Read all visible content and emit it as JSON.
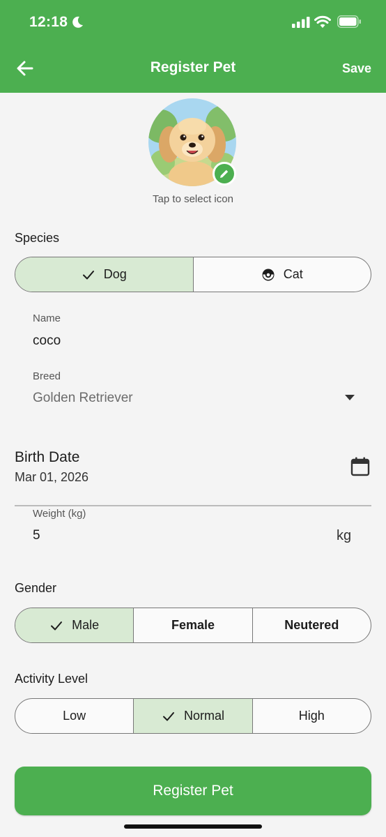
{
  "status_bar": {
    "time": "12:18"
  },
  "header": {
    "title": "Register Pet",
    "save_label": "Save",
    "accent_color": "#4caf50"
  },
  "avatar": {
    "caption": "Tap to select icon"
  },
  "species": {
    "label": "Species",
    "options": [
      {
        "label": "Dog",
        "selected": true,
        "icon": "check-icon"
      },
      {
        "label": "Cat",
        "selected": false,
        "icon": "cat-icon"
      }
    ]
  },
  "name": {
    "label": "Name",
    "value": "coco"
  },
  "breed": {
    "label": "Breed",
    "value": "Golden Retriever"
  },
  "birth_date": {
    "label": "Birth Date",
    "value": "Mar 01, 2026"
  },
  "weight": {
    "label": "Weight (kg)",
    "value": "5",
    "unit": "kg"
  },
  "gender": {
    "label": "Gender",
    "options": [
      {
        "label": "Male",
        "selected": true
      },
      {
        "label": "Female",
        "selected": false
      },
      {
        "label": "Neutered",
        "selected": false
      }
    ]
  },
  "activity": {
    "label": "Activity Level",
    "options": [
      {
        "label": "Low",
        "selected": false
      },
      {
        "label": "Normal",
        "selected": true
      },
      {
        "label": "High",
        "selected": false
      }
    ]
  },
  "submit": {
    "label": "Register Pet"
  }
}
